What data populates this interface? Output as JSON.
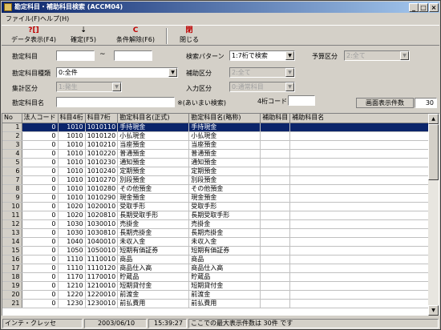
{
  "window": {
    "title": "勘定科目・補助科目検索 (ACCM04)"
  },
  "menu": {
    "file": "ファイル(F)",
    "help": "ヘルプ(H)"
  },
  "toolbar": {
    "display": {
      "icon": "?[]",
      "label": "データ表示(F4)"
    },
    "confirm": {
      "icon": "⇣",
      "label": "確定(F5)"
    },
    "clear": {
      "icon": "C",
      "label": "条件解除(F6)"
    },
    "close": {
      "icon": "閉",
      "label": "閉じる"
    }
  },
  "form": {
    "account_code_label": "勘定科目",
    "account_code_from": "",
    "tilde": "~",
    "account_code_to": "",
    "search_pattern_label": "検索パターン",
    "search_pattern_value": "1:7桁で検索",
    "budget_category_label": "予算区分",
    "budget_category_value": "2:全て",
    "account_type_label": "勘定科目種類",
    "account_type_value": "0:全件",
    "sub_category_label": "補助区分",
    "sub_category_value": "2:全て",
    "tally_category_label": "集計区分",
    "tally_category_value": "1:発生",
    "input_category_label": "入力区分",
    "input_category_value": "0:通常科目",
    "account_name_label": "勘定科目名",
    "account_name_value": "",
    "fuzzy_note": "※(あいまい検索)",
    "four_digit_label": "4桁コード",
    "four_digit_value": "",
    "display_count_label": "画面表示件数",
    "display_count_value": "30"
  },
  "grid": {
    "headers": [
      "No",
      "法人コード",
      "科目4桁",
      "科目7桁",
      "勘定科目名(正式)",
      "勘定科目名(略称)",
      "補助科目",
      "補助科目名"
    ],
    "rows": [
      [
        "1",
        "0",
        "1010",
        "1010110",
        "手持現金",
        "手持現金",
        "",
        ""
      ],
      [
        "2",
        "0",
        "1010",
        "1010120",
        "小払現金",
        "小払現金",
        "",
        ""
      ],
      [
        "3",
        "0",
        "1010",
        "1010210",
        "当座預金",
        "当座預金",
        "",
        ""
      ],
      [
        "4",
        "0",
        "1010",
        "1010220",
        "普通預金",
        "普通預金",
        "",
        ""
      ],
      [
        "5",
        "0",
        "1010",
        "1010230",
        "通知預金",
        "通知預金",
        "",
        ""
      ],
      [
        "6",
        "0",
        "1010",
        "1010240",
        "定期預金",
        "定期預金",
        "",
        ""
      ],
      [
        "7",
        "0",
        "1010",
        "1010270",
        "別段預金",
        "別段預金",
        "",
        ""
      ],
      [
        "8",
        "0",
        "1010",
        "1010280",
        "その他預金",
        "その他預金",
        "",
        ""
      ],
      [
        "9",
        "0",
        "1010",
        "1010290",
        "現金預金",
        "現金預金",
        "",
        ""
      ],
      [
        "10",
        "0",
        "1020",
        "1020010",
        "受取手形",
        "受取手形",
        "",
        ""
      ],
      [
        "11",
        "0",
        "1020",
        "1020810",
        "長期受取手形",
        "長期受取手形",
        "",
        ""
      ],
      [
        "12",
        "0",
        "1030",
        "1030010",
        "売掛金",
        "売掛金",
        "",
        ""
      ],
      [
        "13",
        "0",
        "1030",
        "1030810",
        "長期売掛金",
        "長期売掛金",
        "",
        ""
      ],
      [
        "14",
        "0",
        "1040",
        "1040010",
        "未収入金",
        "未収入金",
        "",
        ""
      ],
      [
        "15",
        "0",
        "1050",
        "1050010",
        "短期有価証券",
        "短期有価証券",
        "",
        ""
      ],
      [
        "16",
        "0",
        "1110",
        "1110010",
        "商品",
        "商品",
        "",
        ""
      ],
      [
        "17",
        "0",
        "1110",
        "1110120",
        "商品仕入高",
        "商品仕入高",
        "",
        ""
      ],
      [
        "18",
        "0",
        "1170",
        "1170010",
        "貯蔵品",
        "貯蔵品",
        "",
        ""
      ],
      [
        "19",
        "0",
        "1210",
        "1210010",
        "短期貸付金",
        "短期貸付金",
        "",
        ""
      ],
      [
        "20",
        "0",
        "1220",
        "1220010",
        "前渡金",
        "前渡金",
        "",
        ""
      ],
      [
        "21",
        "0",
        "1230",
        "1230010",
        "前払費用",
        "前払費用",
        "",
        ""
      ]
    ]
  },
  "status": {
    "user": "インテ・クレッセ",
    "date": "2003/06/10",
    "time": "15:39:27",
    "message": "ここでの最大表示件数は 30件 です"
  }
}
